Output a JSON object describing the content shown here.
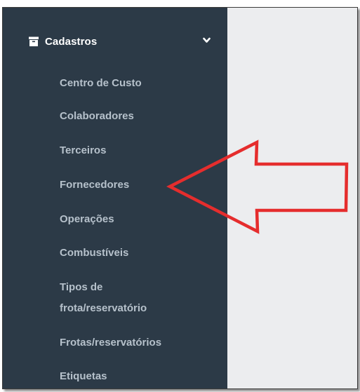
{
  "sidebar": {
    "section": {
      "label": "Cadastros",
      "icon": "archive-icon",
      "expand_icon": "chevron-down-icon",
      "expanded": true
    },
    "items": [
      {
        "label": "Centro de Custo"
      },
      {
        "label": "Colaboradores"
      },
      {
        "label": "Terceiros"
      },
      {
        "label": "Fornecedores",
        "highlighted": true
      },
      {
        "label": "Operações"
      },
      {
        "label": "Combustíveis"
      },
      {
        "label": "Tipos de frota/reservatório"
      },
      {
        "label": "Frotas/reservatórios"
      },
      {
        "label": "Etiquetas"
      }
    ]
  },
  "annotation": {
    "type": "arrow",
    "color": "#e52d2d",
    "points_to": "Fornecedores"
  },
  "colors": {
    "sidebar_bg": "#2c3a47",
    "content_bg": "#ecedef",
    "item_text": "#b6c1cb",
    "header_text": "#ffffff"
  }
}
